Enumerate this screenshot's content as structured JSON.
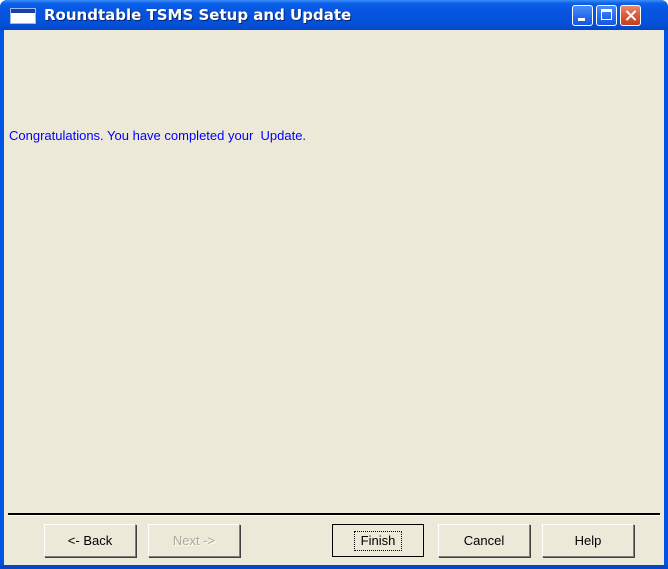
{
  "window": {
    "title": "Roundtable TSMS Setup and Update",
    "icon": "application-window-icon"
  },
  "caption_buttons": {
    "minimize": "minimize-icon",
    "maximize": "maximize-icon",
    "close": "close-icon"
  },
  "main": {
    "message": "Congratulations. You have completed your  Update."
  },
  "buttons": {
    "back": {
      "label": "<- Back",
      "enabled": true
    },
    "next": {
      "label": "Next ->",
      "enabled": false
    },
    "finish": {
      "label": "Finish",
      "enabled": true,
      "default": true
    },
    "cancel": {
      "label": "Cancel",
      "enabled": true
    },
    "help": {
      "label": "Help",
      "enabled": true
    }
  },
  "colors": {
    "titlebar": "#0054e3",
    "client_bg": "#ece9d8",
    "message_text": "#0000ff",
    "disabled_text": "#aca899"
  }
}
